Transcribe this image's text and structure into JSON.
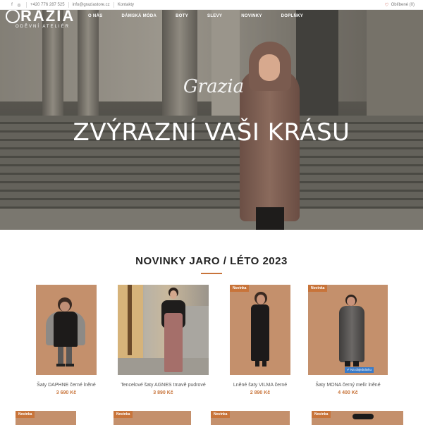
{
  "topbar": {
    "phone": "+420 776 287 525",
    "email": "info@graziastore.cz",
    "contacts": "Kontakty",
    "favorites": "Oblíbené (0)"
  },
  "logo": {
    "main": "RAZIA",
    "sub": "ODĚVNÍ ATELIÉR"
  },
  "nav": [
    "O NÁS",
    "DÁMSKÁ MÓDA",
    "BOTY",
    "SLEVY",
    "NOVINKY",
    "DOPLŇKY"
  ],
  "hero": {
    "script": "Grazia",
    "tagline": "ZVÝRAZNÍ VAŠI KRÁSU"
  },
  "section": {
    "title": "NOVINKY JARO / LÉTO 2023"
  },
  "products": [
    {
      "name": "Šaty DAPHNE černé lněné",
      "price": "3 690 Kč",
      "badge": ""
    },
    {
      "name": "Tencelové šaty AGNES tmavě pudrové",
      "price": "3 890 Kč",
      "badge": ""
    },
    {
      "name": "Lněné šaty VILMA černé",
      "price": "2 890 Kč",
      "badge": "Novinka"
    },
    {
      "name": "Šaty MONA černý melír lněné",
      "price": "4 400 Kč",
      "badge": "Novinka",
      "stock": "Na objednávku"
    }
  ],
  "row2_badges": [
    "Novinka",
    "Novinka",
    "Novinka",
    "Novinka"
  ],
  "colors": {
    "accent": "#c8743a",
    "stock": "#3a7bc8"
  }
}
